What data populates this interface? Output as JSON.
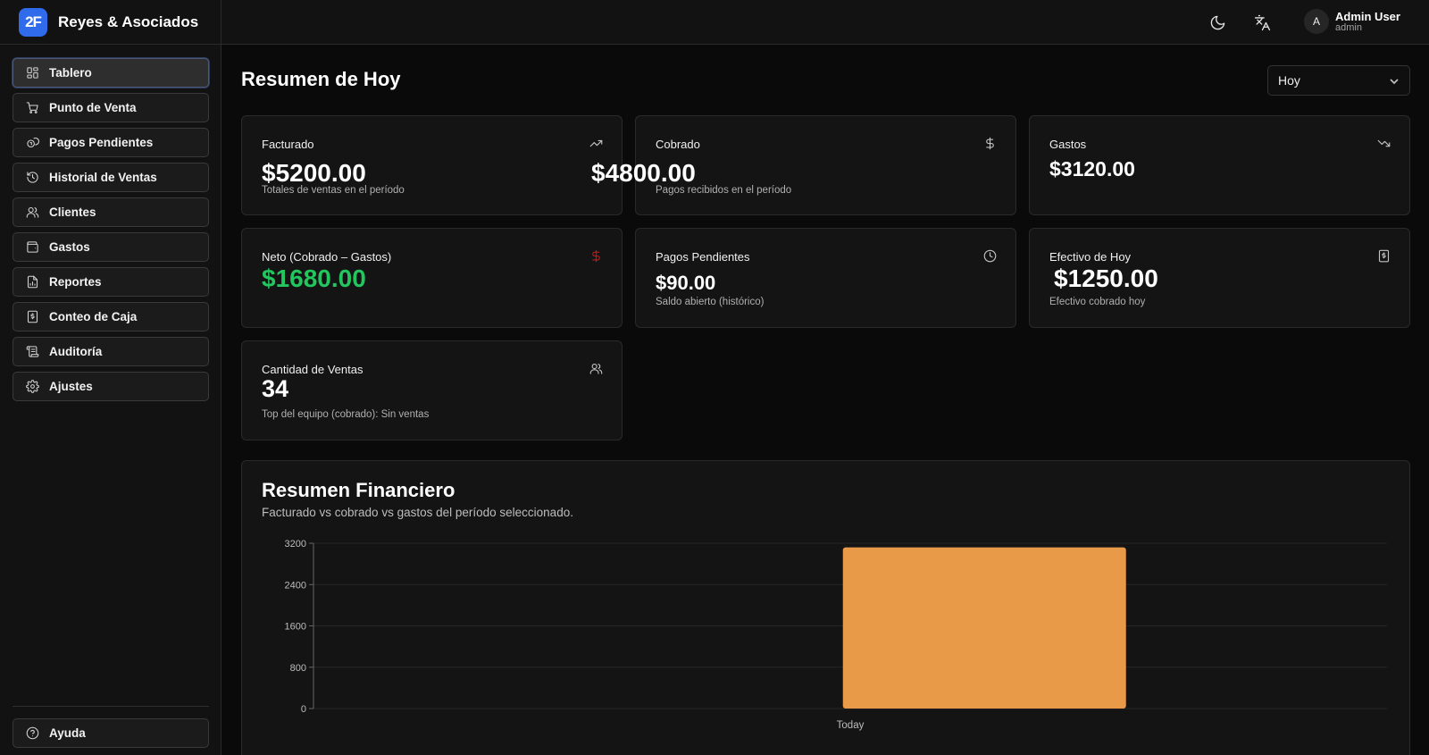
{
  "app": {
    "logo_text": "2F",
    "name": "Reyes & Asociados"
  },
  "sidebar": {
    "items": [
      {
        "label": "Tablero",
        "icon": "dashboard-icon"
      },
      {
        "label": "Punto de Venta",
        "icon": "cart-icon"
      },
      {
        "label": "Pagos Pendientes",
        "icon": "coins-icon"
      },
      {
        "label": "Historial de Ventas",
        "icon": "history-icon"
      },
      {
        "label": "Clientes",
        "icon": "users-icon"
      },
      {
        "label": "Gastos",
        "icon": "wallet-icon"
      },
      {
        "label": "Reportes",
        "icon": "report-icon"
      },
      {
        "label": "Conteo de Caja",
        "icon": "cash-register-icon"
      },
      {
        "label": "Auditoría",
        "icon": "audit-icon"
      },
      {
        "label": "Ajustes",
        "icon": "settings-icon"
      }
    ],
    "help_label": "Ayuda"
  },
  "topbar": {
    "theme_icon": "moon-icon",
    "language_icon": "translate-icon",
    "user": {
      "initial": "A",
      "name": "Admin User",
      "role": "admin"
    }
  },
  "main": {
    "title": "Resumen de Hoy",
    "period": "Hoy",
    "cards": {
      "facturado": {
        "label": "Facturado",
        "value": "$5200.00",
        "sub": "Totales de ventas en el período",
        "icon": "trending-up-icon"
      },
      "cobrado": {
        "label": "Cobrado",
        "value": "$4800.00",
        "sub": "Pagos recibidos en el período",
        "icon": "dollar-icon"
      },
      "gastos": {
        "label": "Gastos",
        "value": "$3120.00",
        "icon": "trending-down-icon"
      },
      "neto": {
        "label": "Neto (Cobrado – Gastos)",
        "value": "$1680.00",
        "icon": "dollar-icon",
        "value_color": "#22c55e",
        "icon_color": "#b91c1c"
      },
      "pendientes": {
        "label": "Pagos Pendientes",
        "value": "$90.00",
        "sub": "Saldo abierto (histórico)",
        "icon": "clock-icon"
      },
      "efectivo": {
        "label": "Efectivo de Hoy",
        "value": "$1250.00",
        "sub": "Efectivo cobrado hoy",
        "icon": "cash-register-icon"
      },
      "cantidad": {
        "label": "Cantidad de Ventas",
        "value": "34",
        "sub": "Top del equipo (cobrado): Sin ventas",
        "icon": "users-icon"
      }
    }
  },
  "chart_data": {
    "type": "bar",
    "title": "Resumen Financiero",
    "subtitle": "Facturado vs cobrado vs gastos del período seleccionado.",
    "categories": [
      "Today"
    ],
    "series": [
      {
        "values": [
          3120
        ],
        "color": "#e89a48"
      }
    ],
    "yticks": [
      0,
      800,
      1600,
      2400,
      3200
    ],
    "ylim": [
      0,
      3200
    ],
    "grid": true
  }
}
